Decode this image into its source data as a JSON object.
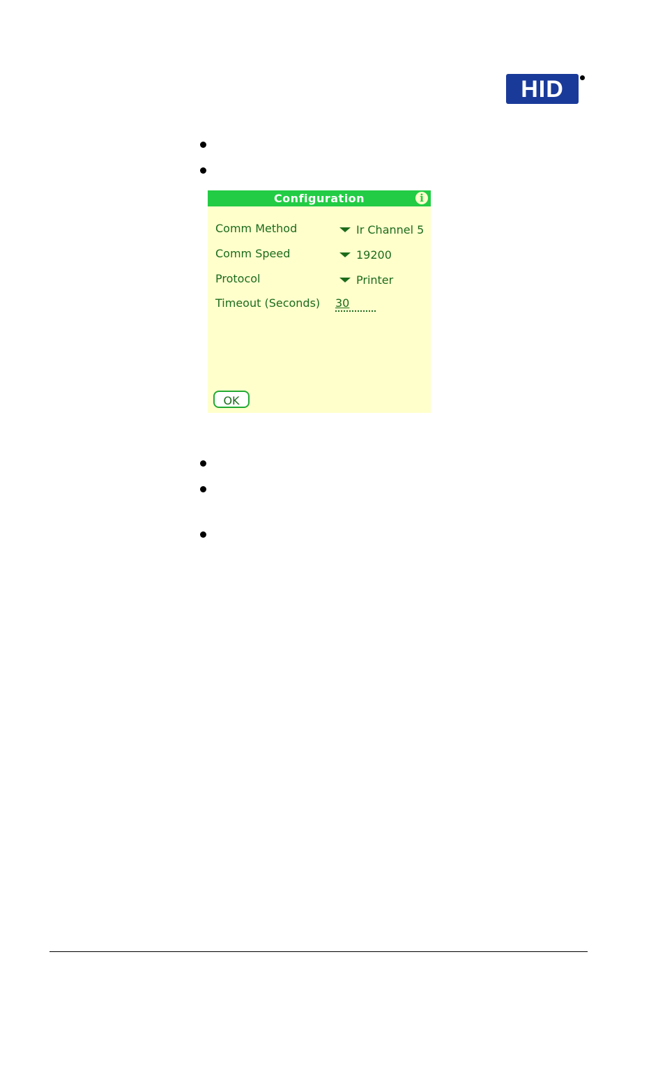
{
  "header": {
    "logo_text": "HID",
    "logo_color": "#1a3a9a"
  },
  "dialog": {
    "title": "Configuration",
    "info_icon": "info-icon",
    "title_color": "#22cc44",
    "background_color": "#ffffcc",
    "fields": [
      {
        "label": "Comm Method",
        "type": "picker",
        "value": "Ir Channel 5"
      },
      {
        "label": "Comm Speed",
        "type": "picker",
        "value": "19200"
      },
      {
        "label": "Protocol",
        "type": "picker",
        "value": "Printer"
      },
      {
        "label": "Timeout (Seconds)",
        "type": "text",
        "value": "30"
      }
    ],
    "ok_label": "OK"
  },
  "bullets_before": 2,
  "bullets_after": 3
}
